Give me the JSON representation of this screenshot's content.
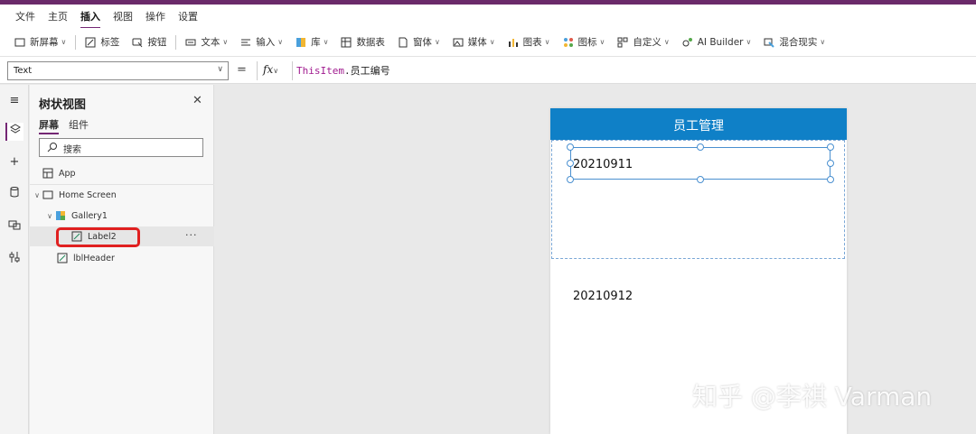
{
  "menubar": {
    "items": [
      {
        "label": "文件"
      },
      {
        "label": "主页"
      },
      {
        "label": "插入",
        "active": true
      },
      {
        "label": "视图"
      },
      {
        "label": "操作"
      },
      {
        "label": "设置"
      }
    ]
  },
  "ribbon": {
    "new_screen": "新屏幕",
    "label": "标签",
    "button": "按钮",
    "text": "文本",
    "input": "输入",
    "gallery": "库",
    "data_table": "数据表",
    "forms": "窗体",
    "media": "媒体",
    "charts": "图表",
    "icons": "图标",
    "custom": "自定义",
    "ai_builder": "AI Builder",
    "mixed_reality": "混合现实"
  },
  "formula": {
    "property": "Text",
    "equals": "=",
    "fx": "fx",
    "keyword": "ThisItem",
    "field": ".员工编号"
  },
  "tree": {
    "title": "树状视图",
    "tab_screens": "屏幕",
    "tab_components": "组件",
    "search_placeholder": "搜索",
    "nodes": [
      {
        "label": "App"
      },
      {
        "label": "Home Screen"
      },
      {
        "label": "Gallery1"
      },
      {
        "label": "Label2"
      },
      {
        "label": "lblHeader"
      }
    ],
    "more": "···"
  },
  "canvas": {
    "header_title": "员工管理",
    "items": [
      "20210911",
      "20210912"
    ]
  },
  "watermark": "知乎 @李祺 Varman",
  "colors": {
    "accent": "#742774",
    "header_blue": "#0f80c7",
    "highlight_red": "#e02020",
    "selection_blue": "#4a90d0"
  }
}
